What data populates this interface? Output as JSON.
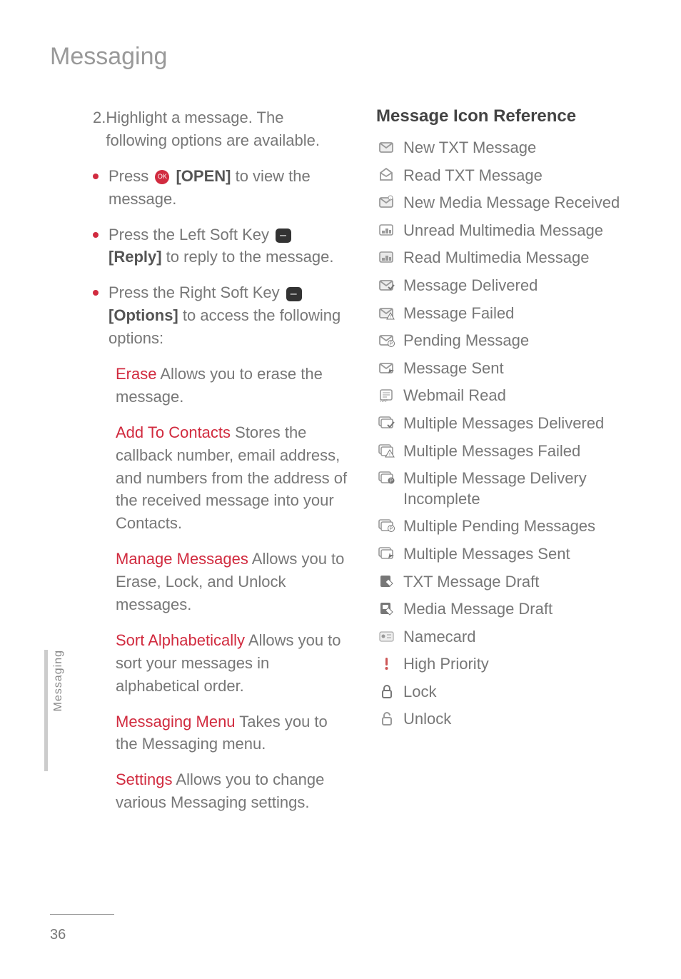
{
  "page": {
    "title": "Messaging",
    "side_tab": "Messaging",
    "page_number": "36"
  },
  "left": {
    "step_num": "2.",
    "step_text": "Highlight a message. The following options are available.",
    "bullets": [
      {
        "pre": "Press ",
        "icon": "ok",
        "bracket": "[OPEN]",
        "post": " to view the message."
      },
      {
        "pre": "Press the Left Soft Key ",
        "icon": "softkey",
        "bracket": "[Reply]",
        "post": " to reply to the message."
      },
      {
        "pre": "Press the Right Soft Key ",
        "icon": "softkey",
        "bracket": "[Options]",
        "post": " to access the following options:"
      }
    ],
    "defs": [
      {
        "term": "Erase",
        "desc": " Allows you to erase the message."
      },
      {
        "term": "Add To Contacts",
        "desc": " Stores the callback number, email address, and numbers from the address of the received message into your Contacts."
      },
      {
        "term": "Manage Messages",
        "desc": " Allows you to Erase, Lock, and Unlock messages."
      },
      {
        "term": "Sort Alphabetically",
        "desc": " Allows you to sort your messages in alphabetical order."
      },
      {
        "term": "Messaging Menu",
        "desc": " Takes you to the Messaging menu."
      },
      {
        "term": "Settings",
        "desc": " Allows you to change various Messaging settings."
      }
    ]
  },
  "right": {
    "heading": "Message Icon Reference",
    "items": [
      {
        "icon": "envelope-closed",
        "label": "New TXT Message"
      },
      {
        "icon": "envelope-open",
        "label": "Read TXT Message"
      },
      {
        "icon": "envelope-music",
        "label": "New Media Message Received"
      },
      {
        "icon": "picture-unread",
        "label": "Unread Multimedia Message"
      },
      {
        "icon": "picture-read",
        "label": "Read Multimedia Message"
      },
      {
        "icon": "envelope-check",
        "label": "Message Delivered"
      },
      {
        "icon": "envelope-warn",
        "label": "Message Failed"
      },
      {
        "icon": "envelope-pending",
        "label": "Pending Message"
      },
      {
        "icon": "envelope-sent",
        "label": "Message Sent"
      },
      {
        "icon": "webmail",
        "label": "Webmail Read"
      },
      {
        "icon": "multi-check",
        "label": "Multiple Messages Delivered"
      },
      {
        "icon": "multi-warn",
        "label": "Multiple Messages Failed"
      },
      {
        "icon": "multi-pending-dark",
        "label": "Multiple Message Delivery Incomplete"
      },
      {
        "icon": "multi-pending",
        "label": "Multiple Pending Messages"
      },
      {
        "icon": "multi-sent",
        "label": "Multiple Messages Sent"
      },
      {
        "icon": "draft-txt",
        "label": "TXT Message Draft"
      },
      {
        "icon": "draft-media",
        "label": "Media Message Draft"
      },
      {
        "icon": "namecard",
        "label": "Namecard"
      },
      {
        "icon": "priority",
        "label": "High Priority"
      },
      {
        "icon": "lock-closed",
        "label": "Lock"
      },
      {
        "icon": "lock-open",
        "label": "Unlock"
      }
    ]
  }
}
